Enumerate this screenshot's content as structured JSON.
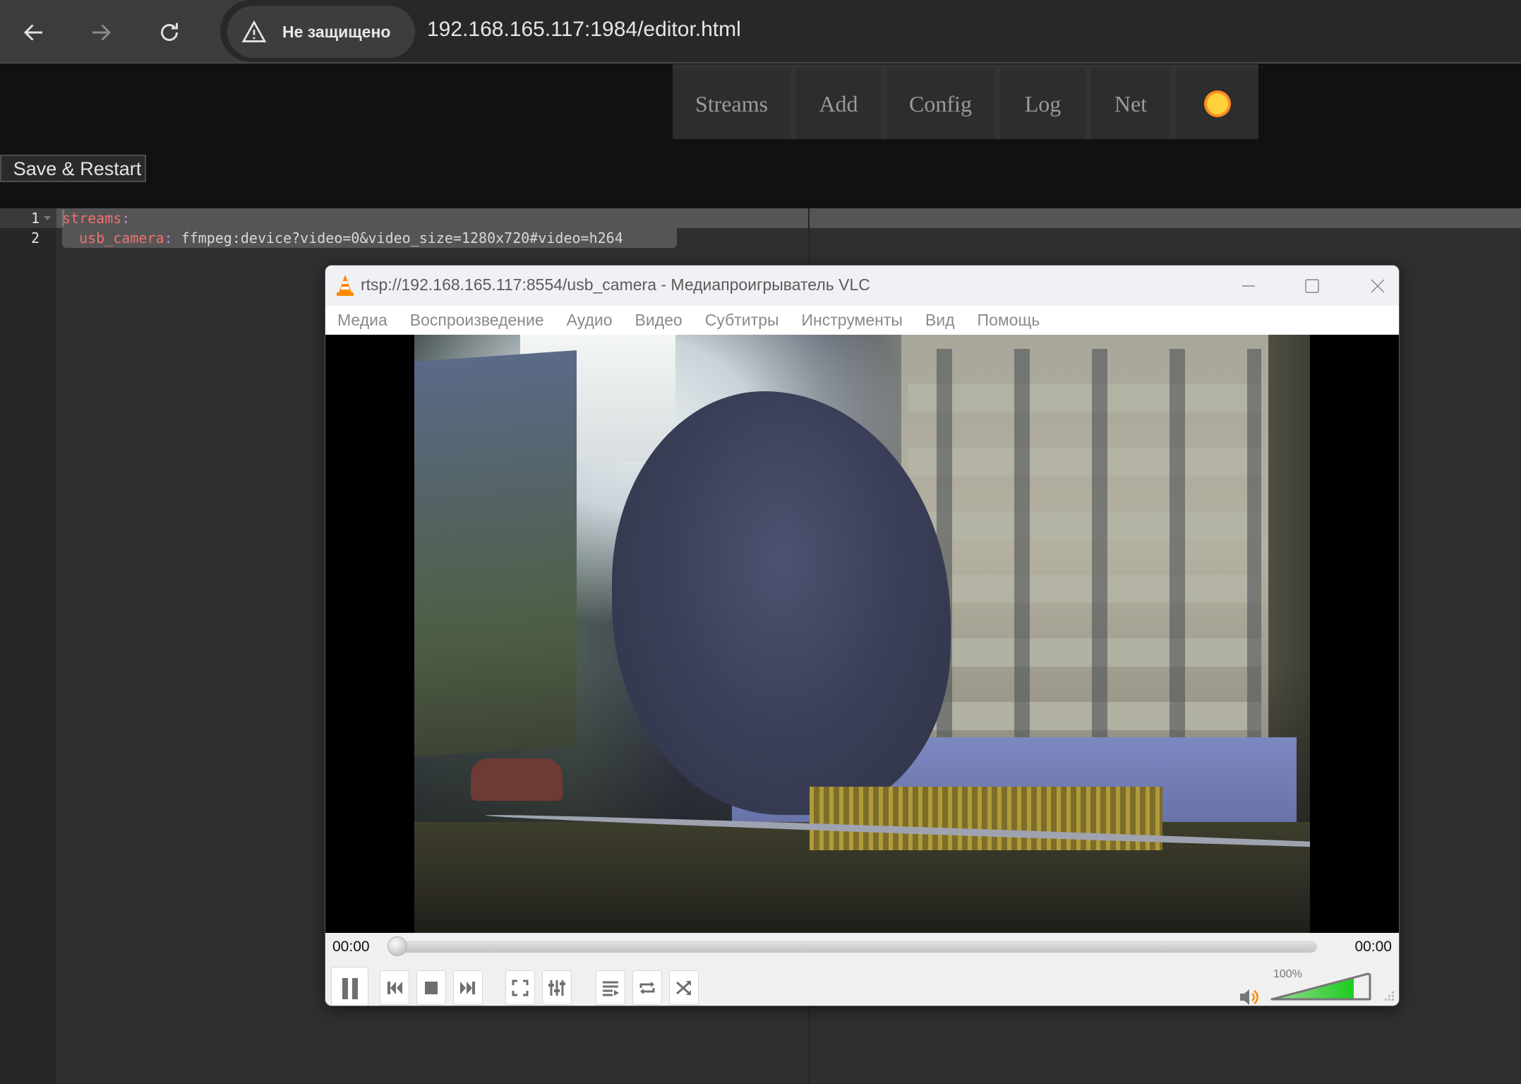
{
  "browser": {
    "security_label": "Не защищено",
    "url": "192.168.165.117:1984/editor.html"
  },
  "nav": {
    "items": [
      {
        "label": "Streams"
      },
      {
        "label": "Add"
      },
      {
        "label": "Config"
      },
      {
        "label": "Log"
      },
      {
        "label": "Net"
      }
    ],
    "theme_icon": "sun-icon",
    "theme_color": "#ffd23c"
  },
  "editor": {
    "save_label": "Save & Restart",
    "lines": [
      {
        "number": "1",
        "key": "streams",
        "sep": ":",
        "value": ""
      },
      {
        "number": "2",
        "indent": "  ",
        "key": "usb_camera",
        "sep": ":",
        "value": " ffmpeg:device?video=0&video_size=1280x720#video=h264"
      }
    ]
  },
  "vlc": {
    "title": "rtsp://192.168.165.117:8554/usb_camera - Медиапроигрыватель VLC",
    "menu": [
      "Медиа",
      "Воспроизведение",
      "Аудио",
      "Видео",
      "Субтитры",
      "Инструменты",
      "Вид",
      "Помощь"
    ],
    "time_elapsed": "00:00",
    "time_total": "00:00",
    "seek_fraction": 0,
    "volume_label": "100%",
    "volume_fraction": 1.0,
    "accent_color": "#ff8800",
    "volume_color": "#22cc22"
  }
}
